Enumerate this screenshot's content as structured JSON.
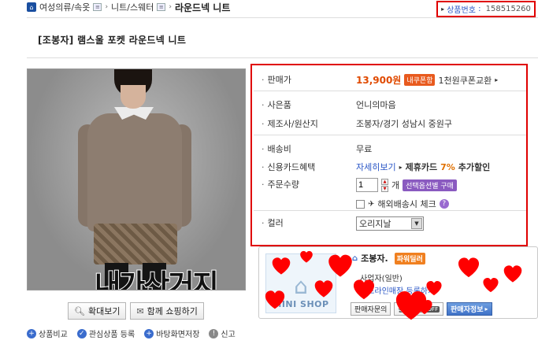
{
  "breadcrumb": {
    "items": [
      "여성의류/속옷",
      "니트/스웨터",
      "라운드넥 니트"
    ]
  },
  "product_no": {
    "label": "상품번호",
    "value": "158515260"
  },
  "title": "[조봉자] 램스울 포켓 라운드넥 니트",
  "photo": {
    "overlay_text": "내가산거지"
  },
  "photo_buttons": {
    "zoom": "확대보기",
    "together": "함께 쇼핑하기"
  },
  "bottom_links": {
    "compare": "상품비교",
    "wishlist": "관심상품 등록",
    "desktop": "바탕화면저장",
    "report": "신고"
  },
  "info": {
    "price_label": "판매가",
    "price_value": "13,900원",
    "coupon_badge": "내쿠폰함",
    "coupon_text": "1천원쿠폰교환",
    "gift_label": "사은품",
    "gift_value": "언니의마음",
    "maker_label": "제조사/원산지",
    "maker_value": "조봉자/경기 성남시 중원구",
    "shipping_label": "배송비",
    "shipping_value": "무료",
    "card_label": "신용카드혜택",
    "card_link": "자세히보기",
    "card_text_prefix": "제휴카드",
    "card_pct": "7%",
    "card_text_suffix": "추가할인",
    "qty_label": "주문수량",
    "qty_value": "1",
    "qty_unit": "개",
    "qty_badge": "선택옵션별 구매",
    "overseas_text": "해외배송시 체크",
    "color_label": "컬러",
    "color_value": "오리지날"
  },
  "seller": {
    "name": "조봉자.",
    "power_badge": "파워딜러",
    "biz_type": "사업자(일반)",
    "offline_link": "오프라인매장 등록하기",
    "mini_shop": "MINI SHOP",
    "btn_inquiry": "판매자문의",
    "btn_plus": "플러스존",
    "btn_plus_badge": "OFF",
    "btn_info": "판매자정보"
  },
  "colors": {
    "highlight_border": "#e00000",
    "heart": "#ff0000",
    "price": "#e04a00",
    "link": "#2a56c6"
  }
}
